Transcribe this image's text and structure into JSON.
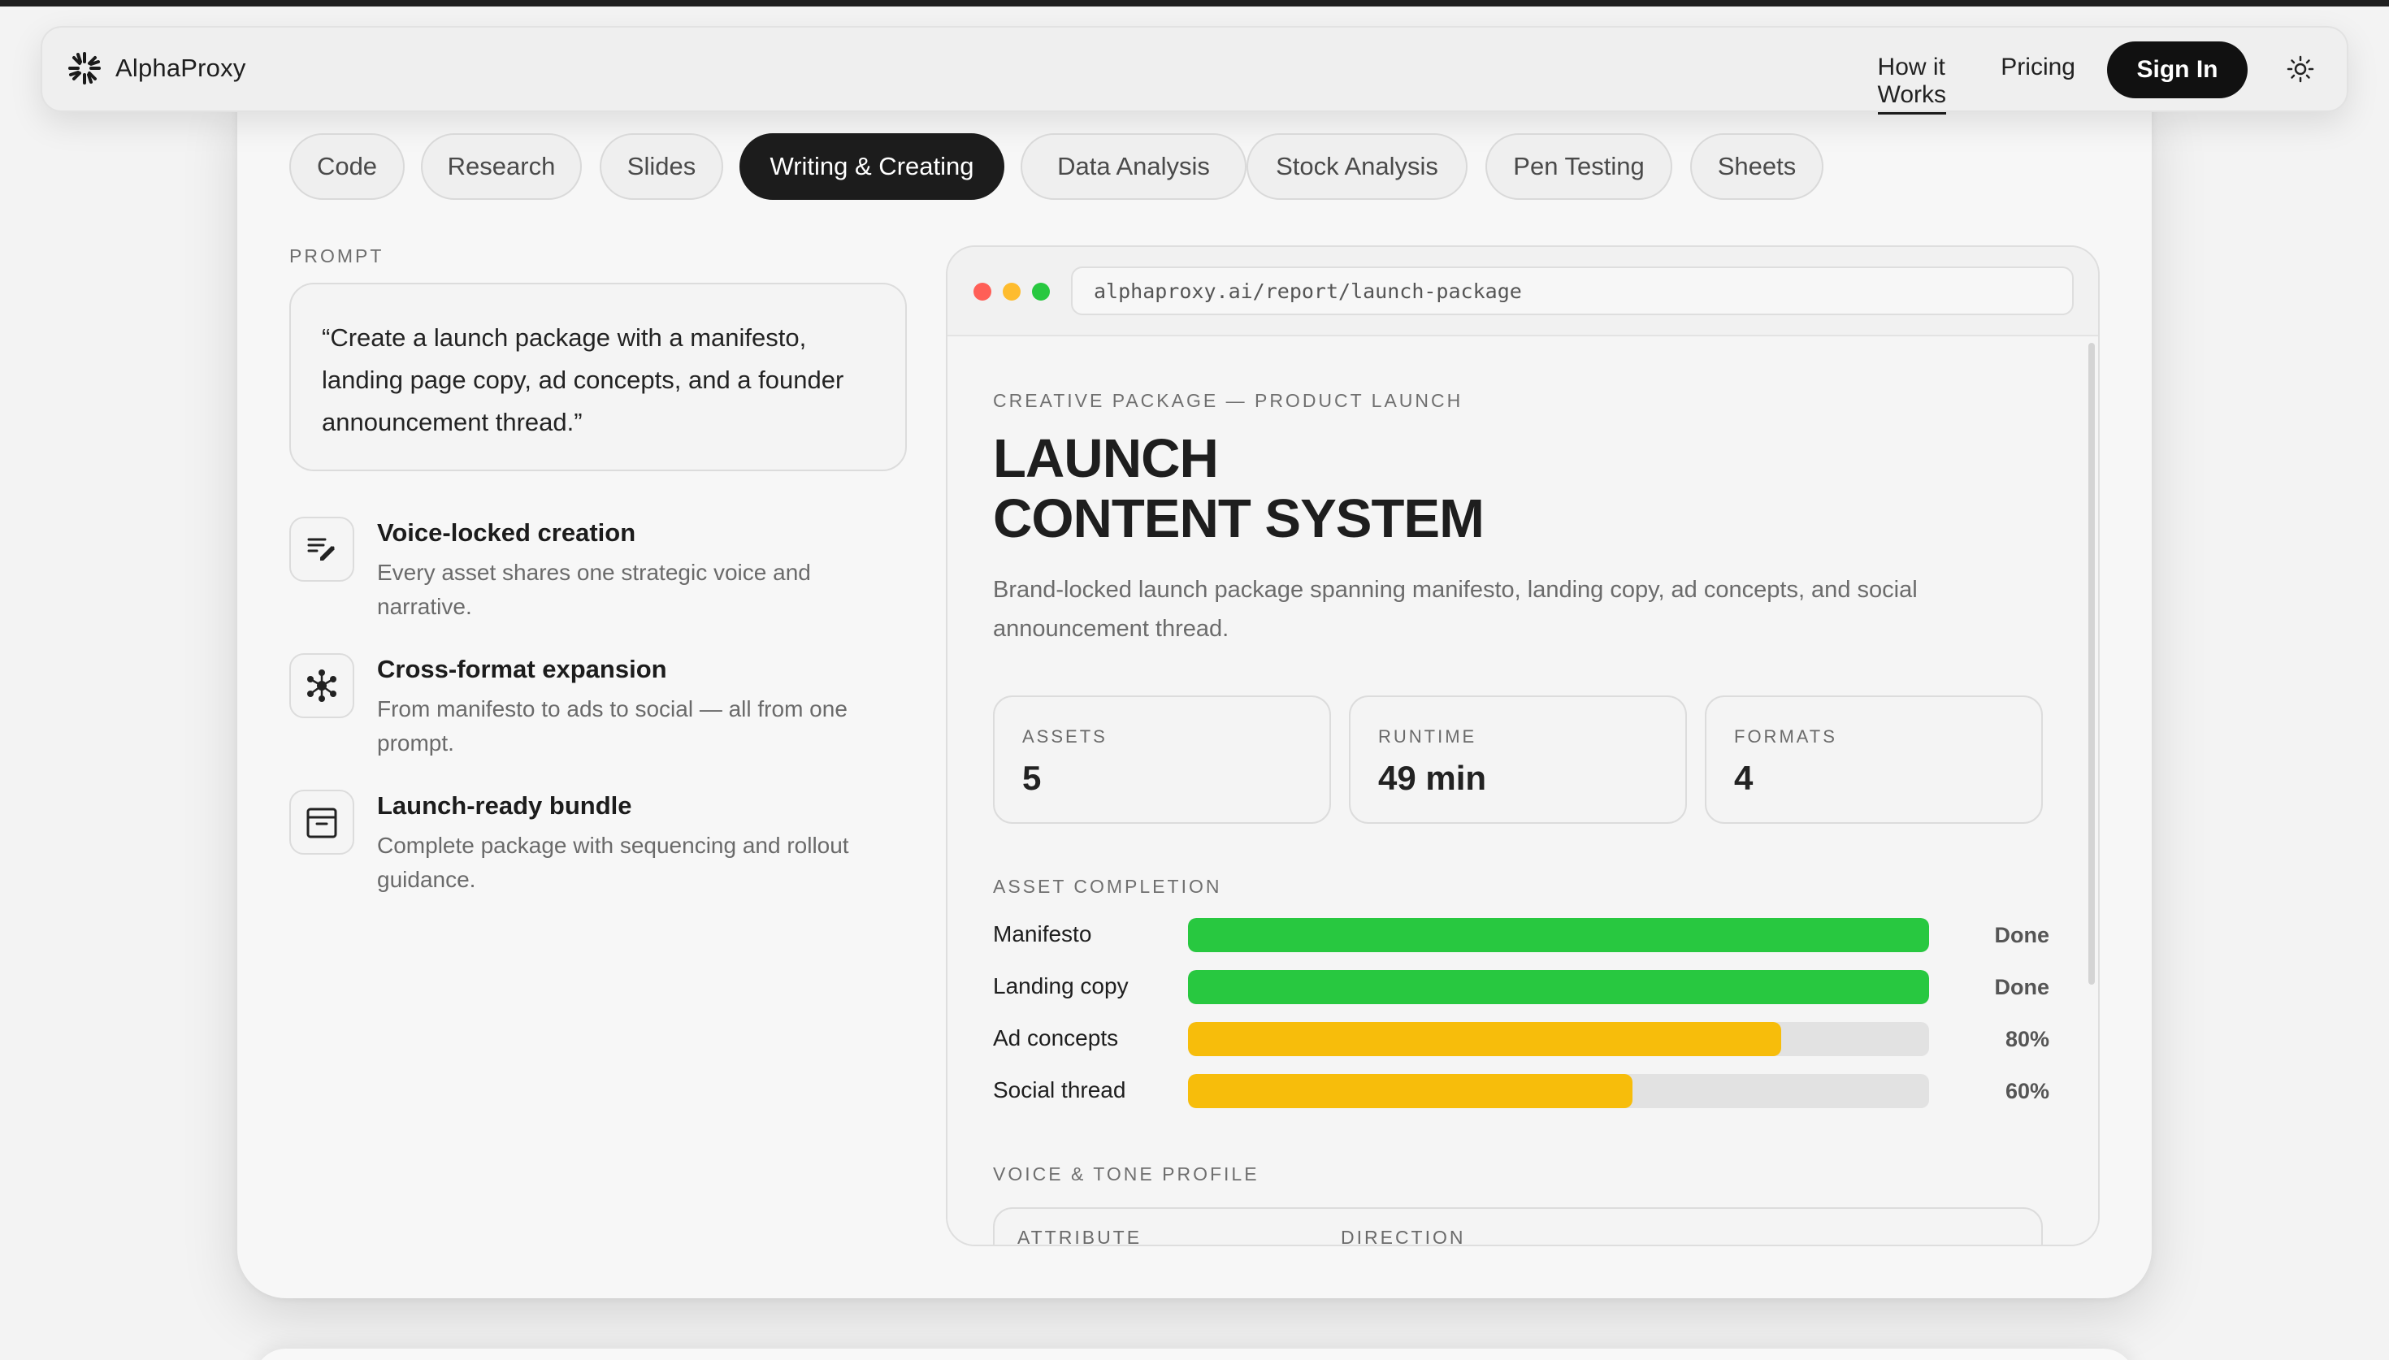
{
  "nav": {
    "brand": "AlphaProxy",
    "links": [
      "How it Works",
      "Pricing"
    ],
    "signin": "Sign In"
  },
  "tabs": [
    "Code",
    "Research",
    "Slides",
    "Writing & Creating",
    "Data Analysis",
    "Stock Analysis",
    "Pen Testing",
    "Sheets"
  ],
  "active_tab": "Writing & Creating",
  "prompt": {
    "label": "PROMPT",
    "text": "“Create a launch package with a manifesto, landing page copy, ad concepts, and a founder announcement thread.”"
  },
  "features": [
    {
      "icon": "edit-lines-icon",
      "title": "Voice-locked creation",
      "desc": "Every asset shares one strategic voice and narrative."
    },
    {
      "icon": "network-icon",
      "title": "Cross-format expansion",
      "desc": "From manifesto to ads to social — all from one prompt."
    },
    {
      "icon": "archive-box-icon",
      "title": "Launch-ready bundle",
      "desc": "Complete package with sequencing and rollout guidance."
    }
  ],
  "browser": {
    "url": "alphaproxy.ai/report/launch-package",
    "eyebrow": "CREATIVE PACKAGE — PRODUCT LAUNCH",
    "title_line1": "LAUNCH",
    "title_line2": "CONTENT SYSTEM",
    "description": "Brand-locked launch package spanning manifesto, landing copy, ad concepts, and social announcement thread.",
    "stats": [
      {
        "label": "ASSETS",
        "value": "5"
      },
      {
        "label": "RUNTIME",
        "value": "49 min"
      },
      {
        "label": "FORMATS",
        "value": "4"
      }
    ],
    "completion_label": "ASSET COMPLETION",
    "completion": [
      {
        "name": "Manifesto",
        "progress": 1.0,
        "status": "Done",
        "color": "#28c840"
      },
      {
        "name": "Landing copy",
        "progress": 1.0,
        "status": "Done",
        "color": "#28c840"
      },
      {
        "name": "Ad concepts",
        "progress": 0.8,
        "status": "80%",
        "color": "#f7bd0b"
      },
      {
        "name": "Social thread",
        "progress": 0.6,
        "status": "60%",
        "color": "#f7bd0b"
      }
    ],
    "voice_label": "VOICE & TONE PROFILE",
    "table_headers": [
      "ATTRIBUTE",
      "DIRECTION"
    ]
  },
  "colors": {
    "traffic_red": "#ff5f57",
    "traffic_yellow": "#febc2e",
    "traffic_green": "#28c840",
    "done_bar": "#28c840",
    "partial_bar": "#f7bd0b"
  }
}
